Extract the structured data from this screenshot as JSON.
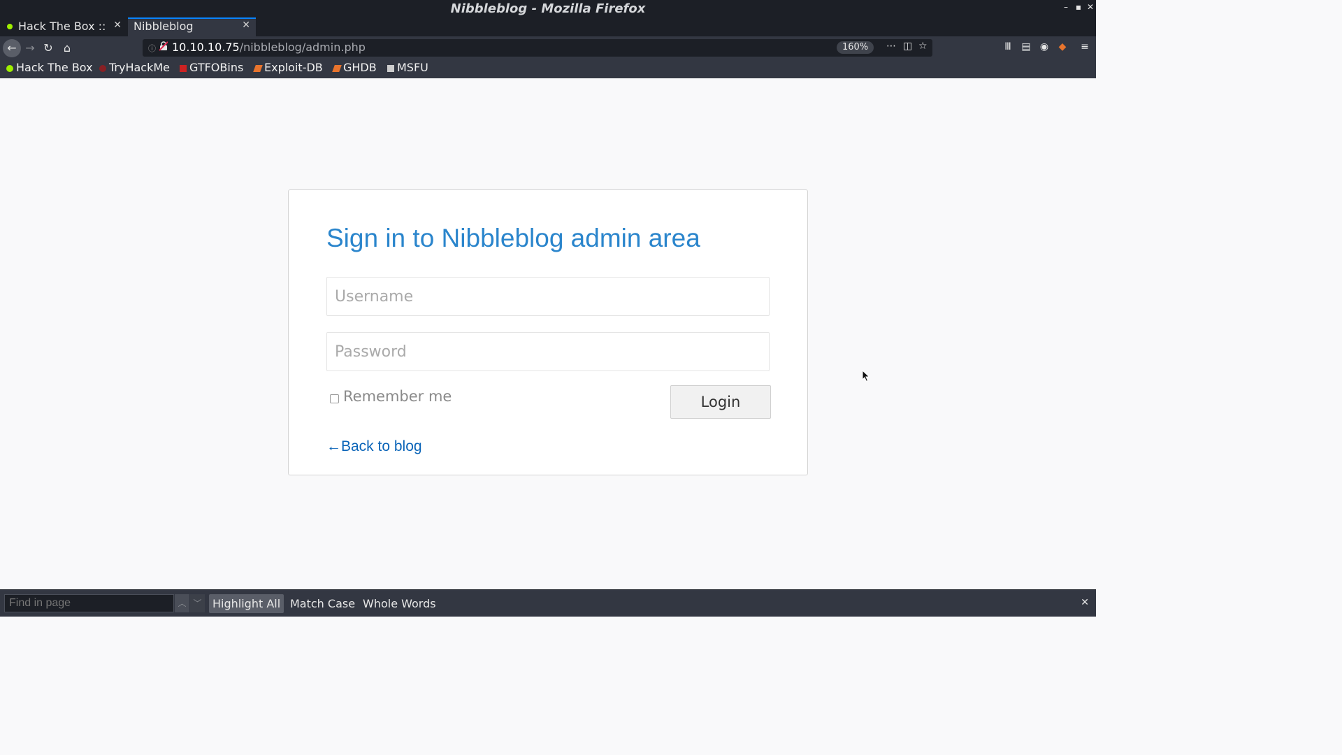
{
  "window": {
    "title": "Nibbleblog - Mozilla Firefox",
    "minimize_glyph": "–",
    "maximize_glyph": "▪",
    "close_glyph": "✕"
  },
  "tabs": [
    {
      "label": "Hack The Box :: M",
      "close": "✕",
      "active": false
    },
    {
      "label": "Nibbleblog",
      "close": "✕",
      "active": true
    }
  ],
  "new_tab_glyph": "+",
  "nav": {
    "back_icon": "←",
    "forward_icon": "→",
    "reload_icon": "↻",
    "home_icon": "⌂"
  },
  "url": {
    "host": "10.10.10.75",
    "path": "/nibbleblog/admin.php",
    "zoom": "160%",
    "more_icon": "⋯",
    "pocket_icon": "◫",
    "bookmark_icon": "☆"
  },
  "toolbar_icons": {
    "library": "Ⅲ",
    "sidebar": "▤",
    "account": "◉",
    "extension": "◆",
    "menu": "≡"
  },
  "bookmarks": [
    {
      "label": "Hack The Box",
      "color": "#9fef00"
    },
    {
      "label": "TryHackMe",
      "color": "#c11111"
    },
    {
      "label": "GTFOBins",
      "color": "#cc2222"
    },
    {
      "label": "Exploit-DB",
      "color": "#e8742d"
    },
    {
      "label": "GHDB",
      "color": "#e8742d"
    },
    {
      "label": "MSFU",
      "color": "#cccccc"
    }
  ],
  "login": {
    "title": "Sign in to Nibbleblog admin area",
    "username_placeholder": "Username",
    "password_placeholder": "Password",
    "remember_label": "Remember me",
    "login_button": "Login",
    "back_link": "←Back to blog"
  },
  "findbar": {
    "placeholder": "Find in page",
    "prev_icon": "︿",
    "next_icon": "﹀",
    "highlight_all": "Highlight All",
    "match_case": "Match Case",
    "whole_words": "Whole Words",
    "close_icon": "✕"
  },
  "colors": {
    "accent": "#0a84ff",
    "title_blue": "#2a85cc",
    "link_blue": "#0a64b8"
  }
}
